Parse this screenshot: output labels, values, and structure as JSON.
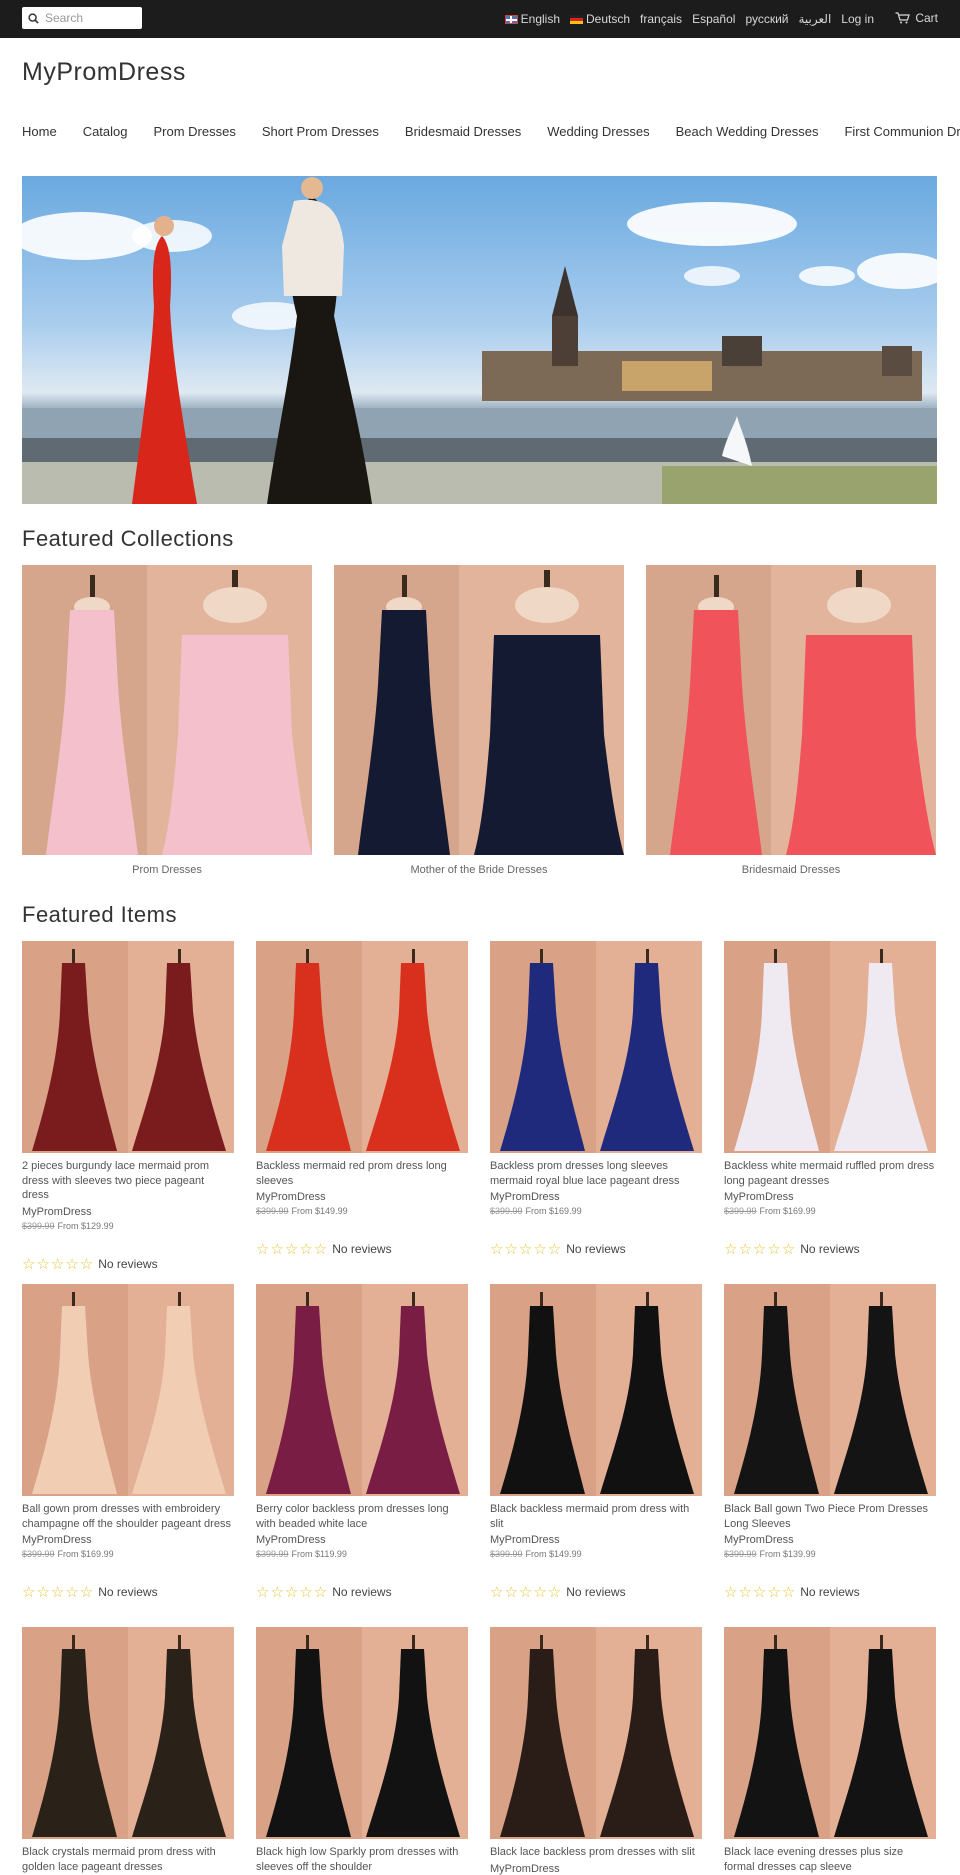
{
  "topbar": {
    "search_placeholder": "Search",
    "languages": [
      "English",
      "Deutsch",
      "français",
      "Español",
      "русский",
      "العربية"
    ],
    "login": "Log in",
    "cart": "Cart"
  },
  "header": {
    "logo": "MyPromDress"
  },
  "nav": [
    "Home",
    "Catalog",
    "Prom Dresses",
    "Short Prom Dresses",
    "Bridesmaid Dresses",
    "Wedding Dresses",
    "Beach Wedding Dresses",
    "First Communion Dresses"
  ],
  "featured_collections": {
    "title": "Featured Collections",
    "items": [
      {
        "caption": "Prom Dresses",
        "color": "#f4c0cc"
      },
      {
        "caption": "Mother of the Bride Dresses",
        "color": "#151a33"
      },
      {
        "caption": "Bridesmaid Dresses",
        "color": "#f0545a"
      }
    ]
  },
  "featured_items": {
    "title": "Featured Items",
    "no_reviews": "No reviews",
    "products": [
      {
        "title": "2 pieces burgundy lace mermaid prom dress with sleeves two piece pageant dress",
        "vendor": "MyPromDress",
        "old_price": "$399.99",
        "price": "From $129.99",
        "color": "#7a1b1e"
      },
      {
        "title": "Backless mermaid red prom dress long sleeves",
        "vendor": "MyPromDress",
        "old_price": "$399.99",
        "price": "From $149.99",
        "color": "#d8301c"
      },
      {
        "title": "Backless prom dresses long sleeves mermaid royal blue lace pageant dress",
        "vendor": "MyPromDress",
        "old_price": "$399.99",
        "price": "From $169.99",
        "color": "#1f2a7c"
      },
      {
        "title": "Backless white mermaid ruffled prom dress long pageant dresses",
        "vendor": "MyPromDress",
        "old_price": "$399.99",
        "price": "From $169.99",
        "color": "#efe9f2"
      },
      {
        "title": "Ball gown prom dresses with embroidery champagne off the shoulder pageant dress",
        "vendor": "MyPromDress",
        "old_price": "$399.99",
        "price": "From $169.99",
        "color": "#f1cdb4"
      },
      {
        "title": "Berry color backless prom dresses long with beaded white lace",
        "vendor": "MyPromDress",
        "old_price": "$399.99",
        "price": "From $119.99",
        "color": "#7a1d45"
      },
      {
        "title": "Black backless mermaid prom dress with slit",
        "vendor": "MyPromDress",
        "old_price": "$399.99",
        "price": "From $149.99",
        "color": "#111111"
      },
      {
        "title": "Black Ball gown Two Piece Prom Dresses Long Sleeves",
        "vendor": "MyPromDress",
        "old_price": "$399.99",
        "price": "From $139.99",
        "color": "#141414"
      },
      {
        "title": "Black crystals mermaid prom dress with golden lace pageant dresses",
        "color": "#2a2118"
      },
      {
        "title": "Black high low Sparkly prom dresses with sleeves off the shoulder",
        "color": "#121212"
      },
      {
        "title": "Black lace backless prom dresses with slit",
        "vendor": "MyPromDress",
        "color": "#2a1d18"
      },
      {
        "title": "Black lace evening dresses plus size formal dresses cap sleeve",
        "color": "#131313"
      }
    ]
  },
  "colors": {
    "topbar": "#1c1c1c",
    "background": "#ffffff",
    "star": "#e8c43a",
    "dress_bg": "#d9a48a"
  }
}
